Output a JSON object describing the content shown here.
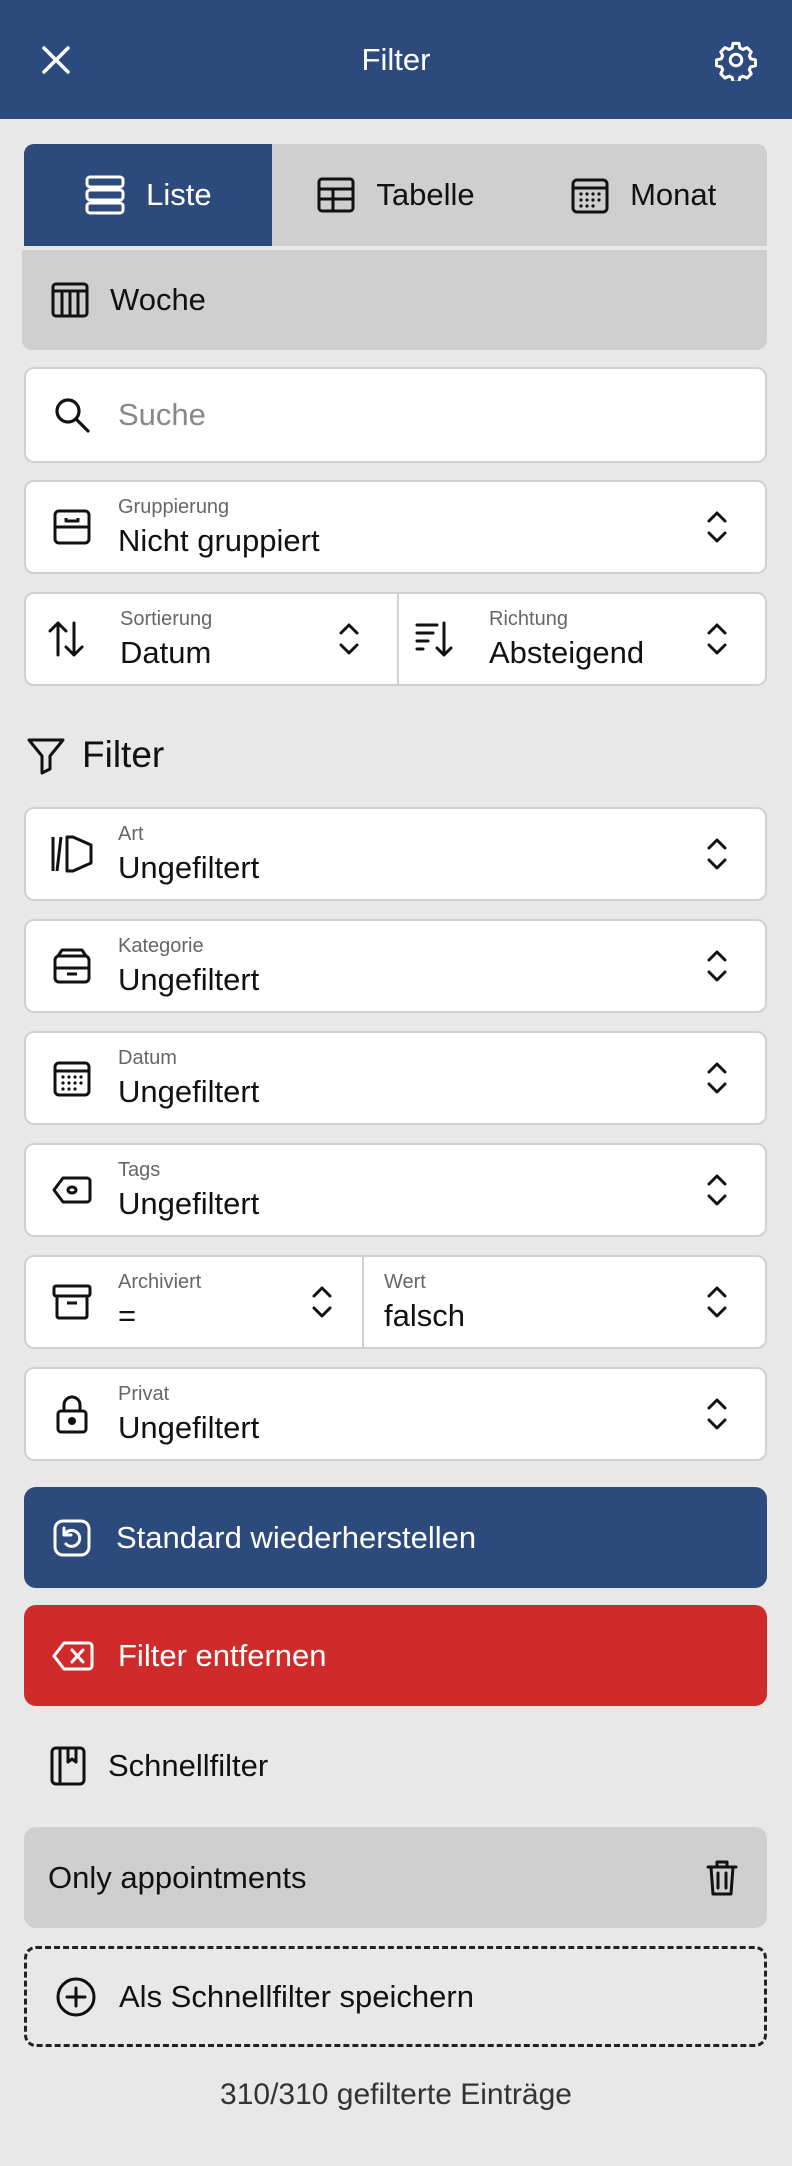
{
  "header": {
    "title": "Filter"
  },
  "view_modes": {
    "list": "Liste",
    "table": "Tabelle",
    "month": "Monat",
    "week": "Woche"
  },
  "search": {
    "placeholder": "Suche"
  },
  "grouping": {
    "label": "Gruppierung",
    "value": "Nicht gruppiert"
  },
  "sorting": {
    "label": "Sortierung",
    "value": "Datum"
  },
  "direction": {
    "label": "Richtung",
    "value": "Absteigend"
  },
  "filter_section": {
    "title": "Filter"
  },
  "filters": {
    "type": {
      "label": "Art",
      "value": "Ungefiltert"
    },
    "category": {
      "label": "Kategorie",
      "value": "Ungefiltert"
    },
    "date": {
      "label": "Datum",
      "value": "Ungefiltert"
    },
    "tags": {
      "label": "Tags",
      "value": "Ungefiltert"
    },
    "archived": {
      "label": "Archiviert",
      "value": "="
    },
    "archived_value": {
      "label": "Wert",
      "value": "falsch"
    },
    "private": {
      "label": "Privat",
      "value": "Ungefiltert"
    }
  },
  "buttons": {
    "restore": "Standard wiederherstellen",
    "remove": "Filter entfernen"
  },
  "quick_filters": {
    "title": "Schnellfilter",
    "items": [
      {
        "label": "Only appointments"
      }
    ],
    "save_label": "Als Schnellfilter speichern"
  },
  "status": {
    "count_text": "310/310 gefilterte Einträge"
  },
  "colors": {
    "primary": "#2d4a7c",
    "danger": "#d02b2b",
    "background": "#e8e8e8",
    "segment_inactive": "#cfcfcf"
  }
}
